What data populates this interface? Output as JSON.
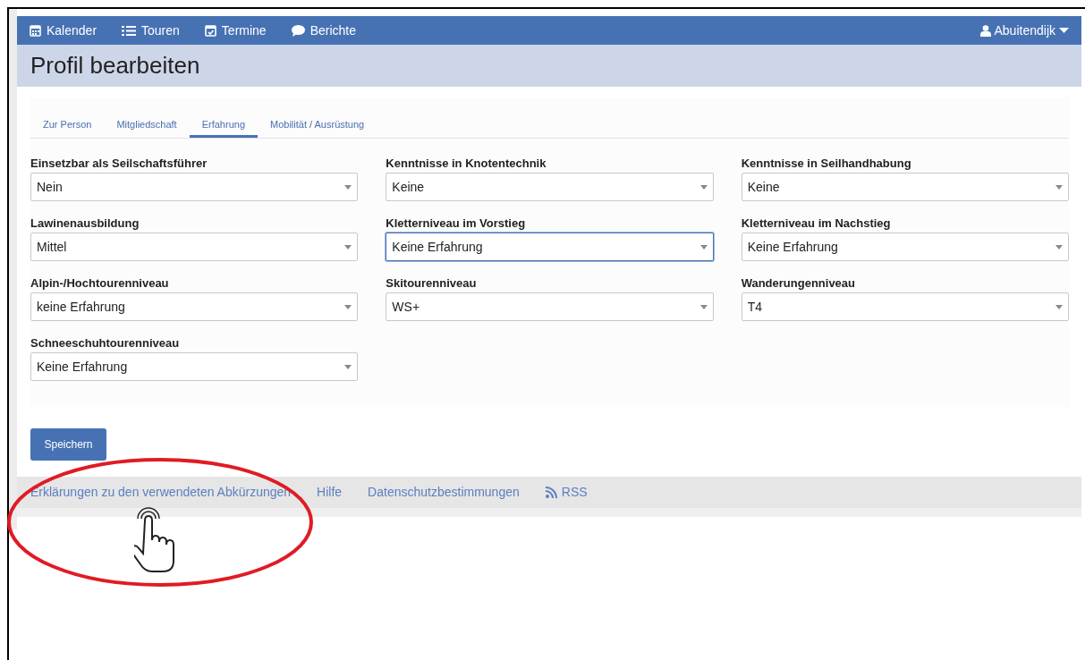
{
  "navbar": {
    "items": [
      {
        "label": "Kalender"
      },
      {
        "label": "Touren"
      },
      {
        "label": "Termine"
      },
      {
        "label": "Berichte"
      }
    ],
    "user": "Abuitendijk"
  },
  "page_title": "Profil bearbeiten",
  "tabs": [
    {
      "label": "Zur Person",
      "selected": false
    },
    {
      "label": "Mitgliedschaft",
      "selected": false
    },
    {
      "label": "Erfahrung",
      "selected": true
    },
    {
      "label": "Mobilität / Ausrüstung",
      "selected": false
    }
  ],
  "fields": [
    {
      "label": "Einsetzbar als Seilschaftsführer",
      "value": "Nein",
      "focused": false
    },
    {
      "label": "Kenntnisse in Knotentechnik",
      "value": "Keine",
      "focused": false
    },
    {
      "label": "Kenntnisse in Seilhandhabung",
      "value": "Keine",
      "focused": false
    },
    {
      "label": "Lawinenausbildung",
      "value": "Mittel",
      "focused": false
    },
    {
      "label": "Kletterniveau im Vorstieg",
      "value": "Keine Erfahrung",
      "focused": true
    },
    {
      "label": "Kletterniveau im Nachstieg",
      "value": "Keine Erfahrung",
      "focused": false
    },
    {
      "label": "Alpin-/Hochtourenniveau",
      "value": "keine Erfahrung",
      "focused": false
    },
    {
      "label": "Skitourenniveau",
      "value": "WS+",
      "focused": false
    },
    {
      "label": "Wanderungenniveau",
      "value": "T4",
      "focused": false
    },
    {
      "label": "Schneeschuhtourenniveau",
      "value": "Keine Erfahrung",
      "focused": false
    }
  ],
  "save_button": "Speichern",
  "footer_links": [
    {
      "label": "Erklärungen zu den verwendeten Abkürzungen"
    },
    {
      "label": "Hilfe"
    },
    {
      "label": "Datenschutzbestimmungen"
    },
    {
      "label": "RSS"
    }
  ]
}
